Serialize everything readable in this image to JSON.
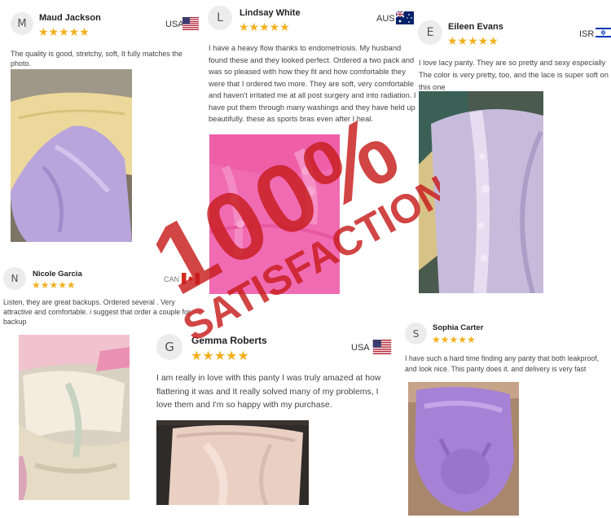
{
  "stamp": {
    "big": "100%",
    "word": "SATISFACTION",
    "color": "#c71c1c"
  },
  "reviews": [
    {
      "initial": "M",
      "name": "Maud Jackson",
      "stars": "★★★★★",
      "country": "USA",
      "text": "The quality is good, stretchy, soft, It fully matches the photo.",
      "photo": "lavender-and-yellow-panties-photo"
    },
    {
      "initial": "L",
      "name": "Lindsay White",
      "stars": "★★★★★",
      "country": "AUS",
      "text": "I have a heavy flow thanks to endometriosis.  My husband found these and they looked perfect. Ordered a two pack and was so pleased with how they fit and how comfortable they were that I ordered two more. They are soft, very comfortable and haven't irritated me at all post surgery and into radiation. I have put them through many washings and they have held up beautifully. these as sports bras even after I heal.",
      "photo": "pink-lace-panty-photo"
    },
    {
      "initial": "E",
      "name": "Eileen Evans",
      "stars": "★★★★★",
      "country": "ISR",
      "text": "I love lacy panty. They are so pretty and sexy especially The color is very pretty, too, and the lace is super soft on this one",
      "photo": "lilac-lace-panty-photo"
    },
    {
      "initial": "N",
      "name": "Nicole Garcia",
      "stars": "★★★★★",
      "country": "CAN",
      "text": "Listen, they are great backups. Ordered several . Very attractive and comfortable. i suggest that order a couple for backup",
      "photo": "pastel-panties-pile-photo"
    },
    {
      "initial": "G",
      "name": "Gemma Roberts",
      "stars": "★★★★★",
      "country": "USA",
      "text": "I am really in love with this panty I was truly amazed at how flattering it was and It really solved many of my problems, I love them and I'm so happy with my purchase.",
      "photo": "beige-panty-photo"
    },
    {
      "initial": "S",
      "name": "Sophia Carter",
      "stars": "★★★★★",
      "country": "",
      "text": "I have such a hard time finding any panty that both leakproof, and look nice. This panty does it. and delivery is very fast",
      "photo": "purple-panty-photo"
    }
  ]
}
